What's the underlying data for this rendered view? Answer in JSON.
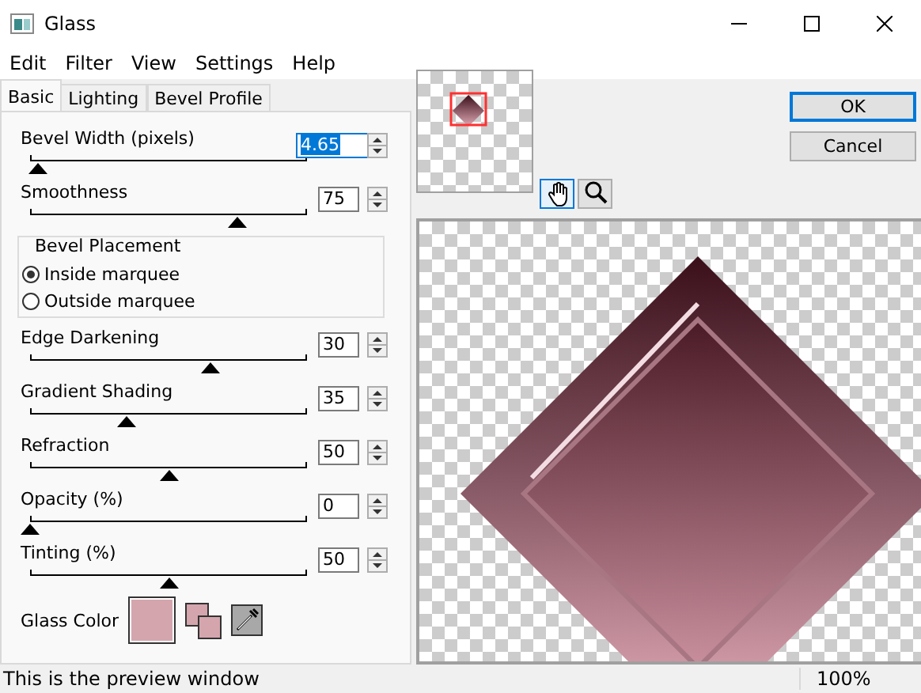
{
  "window": {
    "title": "Glass"
  },
  "menu": [
    "Edit",
    "Filter",
    "View",
    "Settings",
    "Help"
  ],
  "tabs": [
    {
      "label": "Basic",
      "selected": true
    },
    {
      "label": "Lighting",
      "selected": false
    },
    {
      "label": "Bevel Profile",
      "selected": false
    }
  ],
  "controls": [
    {
      "kind": "slider",
      "label": "Bevel Width (pixels)",
      "value": "4.65",
      "level": 0.03,
      "focused": true
    },
    {
      "kind": "slider",
      "label": "Smoothness",
      "value": "75",
      "level": 0.75,
      "focused": false
    },
    {
      "kind": "radio_group",
      "label": "Bevel Placement",
      "options": [
        {
          "label": "Inside marquee",
          "selected": true
        },
        {
          "label": "Outside marquee",
          "selected": false
        }
      ]
    },
    {
      "kind": "slider",
      "label": "Edge Darkening",
      "value": "30",
      "level": 0.65,
      "focused": false
    },
    {
      "kind": "slider",
      "label": "Gradient Shading",
      "value": "35",
      "level": 0.35,
      "focused": false
    },
    {
      "kind": "slider",
      "label": "Refraction",
      "value": "50",
      "level": 0.5,
      "focused": false
    },
    {
      "kind": "slider",
      "label": "Opacity (%)",
      "value": "0",
      "level": 0,
      "focused": false
    },
    {
      "kind": "slider",
      "label": "Tinting (%)",
      "value": "50",
      "level": 0.5,
      "focused": false
    }
  ],
  "glass_color": {
    "label": "Glass Color",
    "color": "#d4a5ad"
  },
  "tools": [
    {
      "kind": "pan",
      "selected": true
    },
    {
      "kind": "zoom",
      "selected": false
    }
  ],
  "buttons": [
    {
      "label": "OK",
      "default": true
    },
    {
      "label": "Cancel",
      "default": false
    }
  ],
  "status_bar": {
    "message": "This is the preview window",
    "zoom": "100%"
  }
}
